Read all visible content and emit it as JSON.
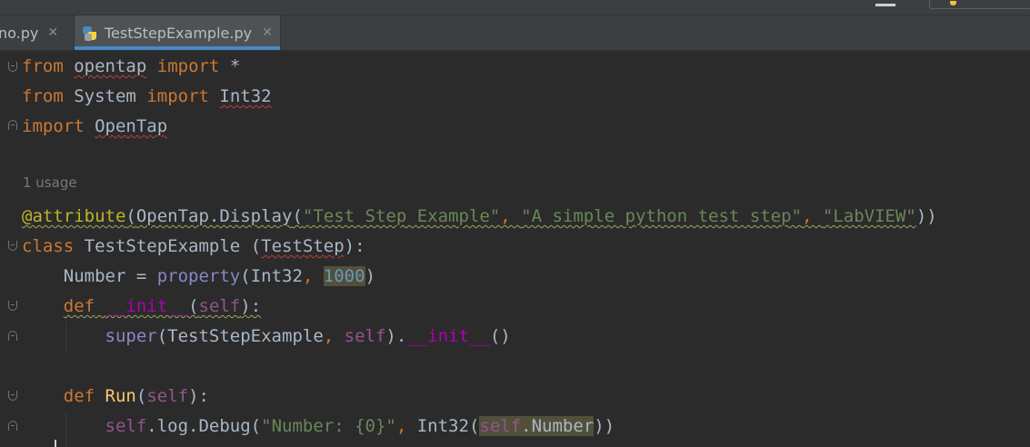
{
  "window": {
    "accent": "#4a88c7"
  },
  "tabs": [
    {
      "label": "no.py",
      "close_icon": "close-icon",
      "active": false
    },
    {
      "label": "TestStepExample.py",
      "close_icon": "close-icon",
      "active": true,
      "icon": "python-file-icon"
    }
  ],
  "editor": {
    "usage_hint": "1 usage",
    "lines": [
      {
        "tokens": [
          "from",
          " ",
          "opentap",
          " ",
          "import",
          " *"
        ]
      },
      {
        "tokens": [
          "from",
          " ",
          "System",
          " ",
          "import",
          " ",
          "Int32"
        ]
      },
      {
        "tokens": [
          "import",
          " ",
          "OpenTap"
        ]
      },
      {
        "tokens": [
          ""
        ]
      },
      {
        "tokens": [
          "@attribute",
          "(",
          "OpenTap.Display",
          "(",
          "\"Test Step Example\"",
          ", ",
          "\"A simple python test step\"",
          ", ",
          "\"LabVIEW\"",
          "))"
        ]
      },
      {
        "tokens": [
          "class",
          " ",
          "TestStepExample",
          " (",
          "TestStep",
          "):"
        ]
      },
      {
        "tokens": [
          "    ",
          "Number",
          " = ",
          "property",
          "(",
          "Int32",
          ", ",
          "1000",
          ")"
        ]
      },
      {
        "tokens": [
          "    ",
          "def",
          " ",
          "__init__",
          "(",
          "self",
          "):"
        ]
      },
      {
        "tokens": [
          "        ",
          "super",
          "(",
          "TestStepExample",
          ", ",
          "self",
          ").",
          "__init__",
          "()"
        ]
      },
      {
        "tokens": [
          ""
        ]
      },
      {
        "tokens": [
          "    ",
          "def",
          " ",
          "Run",
          "(",
          "self",
          "):"
        ]
      },
      {
        "tokens": [
          "        ",
          "self",
          ".log.Debug(",
          "\"Number: {0}\"",
          ", ",
          "Int32",
          "(",
          "self",
          ".Number",
          "))"
        ]
      }
    ]
  },
  "colors": {
    "background": "#2b2b2b",
    "keyword": "#cc7832",
    "string": "#6a8759",
    "number": "#6897bb",
    "self": "#94558d",
    "dunder": "#b200b2",
    "decorator": "#bbb529",
    "builtin": "#8888c6",
    "function": "#ffc66d"
  }
}
